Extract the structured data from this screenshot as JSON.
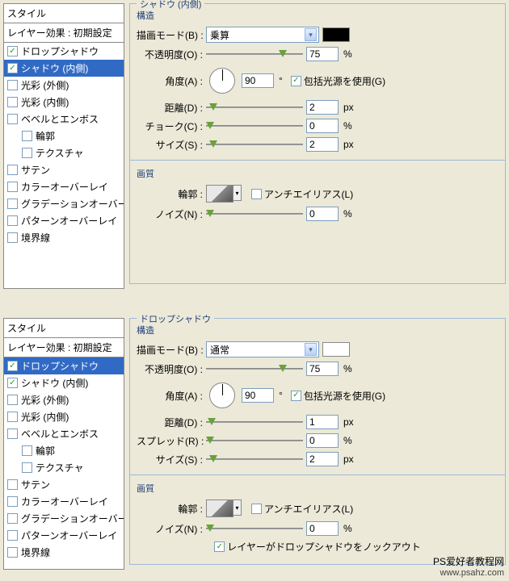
{
  "styles1": {
    "title": "スタイル",
    "sub": "レイヤー効果 : 初期設定",
    "items": [
      {
        "label": "ドロップシャドウ",
        "checked": true,
        "sel": false,
        "indent": false
      },
      {
        "label": "シャドウ (内側)",
        "checked": true,
        "sel": true,
        "indent": false
      },
      {
        "label": "光彩 (外側)",
        "checked": false,
        "sel": false,
        "indent": false
      },
      {
        "label": "光彩 (内側)",
        "checked": false,
        "sel": false,
        "indent": false
      },
      {
        "label": "ベベルとエンボス",
        "checked": false,
        "sel": false,
        "indent": false
      },
      {
        "label": "輪郭",
        "checked": false,
        "sel": false,
        "indent": true
      },
      {
        "label": "テクスチャ",
        "checked": false,
        "sel": false,
        "indent": true
      },
      {
        "label": "サテン",
        "checked": false,
        "sel": false,
        "indent": false
      },
      {
        "label": "カラーオーバーレイ",
        "checked": false,
        "sel": false,
        "indent": false
      },
      {
        "label": "グラデーションオーバーレイ",
        "checked": false,
        "sel": false,
        "indent": false
      },
      {
        "label": "パターンオーバーレイ",
        "checked": false,
        "sel": false,
        "indent": false
      },
      {
        "label": "境界線",
        "checked": false,
        "sel": false,
        "indent": false
      }
    ]
  },
  "panel1": {
    "groupTitle": "シャドウ (内側)",
    "structTitle": "構造",
    "blendMode": {
      "label": "描画モード(B) :",
      "value": "乗算"
    },
    "opacity": {
      "label": "不透明度(O) :",
      "value": "75",
      "unit": "%",
      "pos": 75
    },
    "angle": {
      "label": "角度(A) :",
      "value": "90",
      "useGlobal": "包括光源を使用(G)",
      "checked": true
    },
    "distance": {
      "label": "距離(D) :",
      "value": "2",
      "unit": "px",
      "pos": 3
    },
    "choke": {
      "label": "チョーク(C) :",
      "value": "0",
      "unit": "%",
      "pos": 0
    },
    "size": {
      "label": "サイズ(S) :",
      "value": "2",
      "unit": "px",
      "pos": 3
    },
    "qualityTitle": "画質",
    "contour": {
      "label": "輪郭 :",
      "anti": "アンチエイリアス(L)",
      "checked": false
    },
    "noise": {
      "label": "ノイズ(N) :",
      "value": "0",
      "unit": "%",
      "pos": 0
    }
  },
  "styles2": {
    "title": "スタイル",
    "sub": "レイヤー効果 : 初期設定",
    "items": [
      {
        "label": "ドロップシャドウ",
        "checked": true,
        "sel": true,
        "indent": false
      },
      {
        "label": "シャドウ (内側)",
        "checked": true,
        "sel": false,
        "indent": false
      },
      {
        "label": "光彩 (外側)",
        "checked": false,
        "sel": false,
        "indent": false
      },
      {
        "label": "光彩 (内側)",
        "checked": false,
        "sel": false,
        "indent": false
      },
      {
        "label": "ベベルとエンボス",
        "checked": false,
        "sel": false,
        "indent": false
      },
      {
        "label": "輪郭",
        "checked": false,
        "sel": false,
        "indent": true
      },
      {
        "label": "テクスチャ",
        "checked": false,
        "sel": false,
        "indent": true
      },
      {
        "label": "サテン",
        "checked": false,
        "sel": false,
        "indent": false
      },
      {
        "label": "カラーオーバーレイ",
        "checked": false,
        "sel": false,
        "indent": false
      },
      {
        "label": "グラデーションオーバーレイ",
        "checked": false,
        "sel": false,
        "indent": false
      },
      {
        "label": "パターンオーバーレイ",
        "checked": false,
        "sel": false,
        "indent": false
      },
      {
        "label": "境界線",
        "checked": false,
        "sel": false,
        "indent": false
      }
    ]
  },
  "panel2": {
    "groupTitle": "ドロップシャドウ",
    "structTitle": "構造",
    "blendMode": {
      "label": "描画モード(B) :",
      "value": "通常"
    },
    "opacity": {
      "label": "不透明度(O) :",
      "value": "75",
      "unit": "%",
      "pos": 75
    },
    "angle": {
      "label": "角度(A) :",
      "value": "90",
      "useGlobal": "包括光源を使用(G)",
      "checked": true
    },
    "distance": {
      "label": "距離(D) :",
      "value": "1",
      "unit": "px",
      "pos": 2
    },
    "spread": {
      "label": "スプレッド(R) :",
      "value": "0",
      "unit": "%",
      "pos": 0
    },
    "size": {
      "label": "サイズ(S) :",
      "value": "2",
      "unit": "px",
      "pos": 3
    },
    "qualityTitle": "画質",
    "contour": {
      "label": "輪郭 :",
      "anti": "アンチエイリアス(L)",
      "checked": false
    },
    "noise": {
      "label": "ノイズ(N) :",
      "value": "0",
      "unit": "%",
      "pos": 0
    },
    "knockout": {
      "label": "レイヤーがドロップシャドウをノックアウト",
      "checked": true
    }
  },
  "watermark": {
    "line1": "PS爱好者教程网",
    "line2": "www.psahz.com"
  }
}
